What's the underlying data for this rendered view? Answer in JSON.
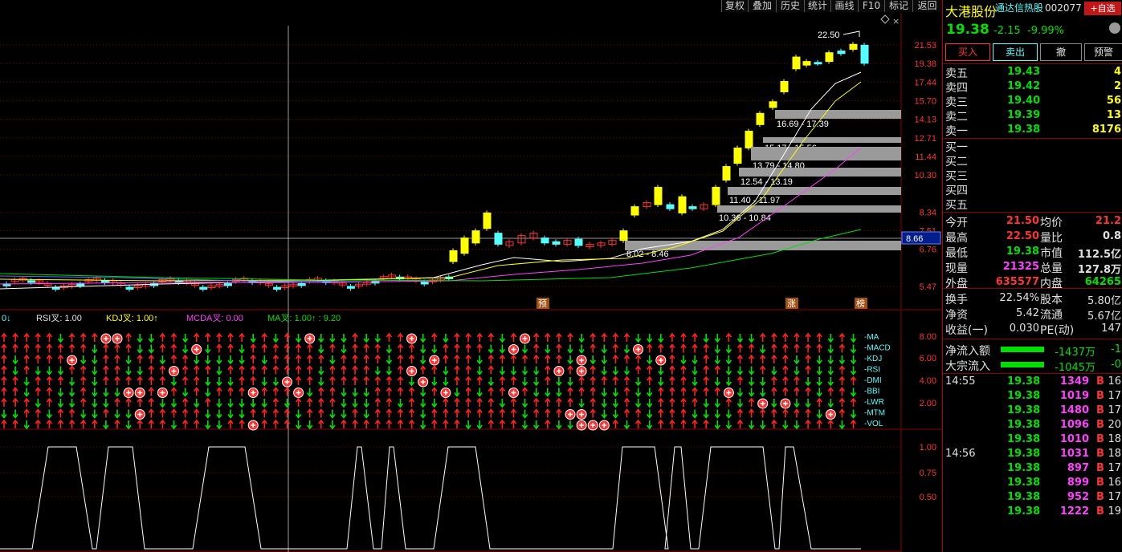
{
  "toolbar": {
    "buttons": [
      "复权",
      "叠加",
      "历史",
      "统计",
      "画线",
      "F10",
      "标记",
      "返回"
    ]
  },
  "colors": {
    "up": "#ff3232",
    "down": "#54ffff",
    "yellow": "#ffff00",
    "green": "#00e000",
    "grid": "#7a0000",
    "magenta": "#ff40ff",
    "gray": "#a0a0a0"
  },
  "main_chart": {
    "price_ticks": [
      "21.53",
      "19.38",
      "17.44",
      "15.70",
      "14.13",
      "12.71",
      "11.44",
      "10.30",
      "8.34",
      "7.51",
      "6.76",
      "5.47"
    ],
    "current_price_tag": "8.66",
    "high_label": "22.50",
    "zone_labels": [
      "16.69 - 17.39",
      "15.17 - 15.56",
      "13.79 - 14.80",
      "12.54 - 13.19",
      "11.40 - 11.97",
      "10.36 - 10.84",
      "8.02 - 8.46"
    ],
    "markers": [
      "预",
      "涨",
      "榜"
    ]
  },
  "indicator_header": {
    "items": [
      {
        "label": "RSI叉: 1.00"
      },
      {
        "label": "KDJ叉: 1.00↑"
      },
      {
        "label": "MCDA叉: 0.00"
      },
      {
        "label": "MA叉: 1.00↑  : 9.20"
      }
    ],
    "prefix": "0↓"
  },
  "signal_rows": {
    "labels": [
      "MA",
      "MACD",
      "KDJ",
      "RSI",
      "DMI",
      "BBI",
      "LWR",
      "MTM",
      "VOL"
    ],
    "axis": [
      "8.00",
      "6.00",
      "4.00",
      "2.00"
    ]
  },
  "bottom_axis": [
    "1.00",
    "0.75",
    "0.50"
  ],
  "quote": {
    "name": "大港股份",
    "source_link": "通达信热股",
    "code": "002077",
    "watch_button": "+自选",
    "price": "19.38",
    "change": "-2.15",
    "change_pct": "-9.99%",
    "buttons": [
      "买入",
      "卖出",
      "撤",
      "预警"
    ],
    "asks": [
      {
        "label": "卖五",
        "price": "19.43",
        "vol": "4"
      },
      {
        "label": "卖四",
        "price": "19.42",
        "vol": "2"
      },
      {
        "label": "卖三",
        "price": "19.40",
        "vol": "56"
      },
      {
        "label": "卖二",
        "price": "19.39",
        "vol": "13"
      },
      {
        "label": "卖一",
        "price": "19.38",
        "vol": "8176"
      }
    ],
    "bids": [
      {
        "label": "买一"
      },
      {
        "label": "买二"
      },
      {
        "label": "买三"
      },
      {
        "label": "买四"
      },
      {
        "label": "买五"
      }
    ],
    "stats": [
      {
        "l1": "今开",
        "v1": "21.50",
        "l2": "均价",
        "v2": "21.2"
      },
      {
        "l1": "最高",
        "v1": "22.50",
        "l2": "量比",
        "v2": "0.8"
      },
      {
        "l1": "最低",
        "v1": "19.38",
        "l2": "市值",
        "v2": "112.5亿"
      },
      {
        "l1": "现量",
        "v1": "21325",
        "l2": "总量",
        "v2": "127.8万"
      },
      {
        "l1": "外盘",
        "v1": "635577",
        "l2": "内盘",
        "v2": "64265"
      }
    ],
    "stats2": [
      {
        "l1": "换手",
        "v1": "22.54%",
        "l2": "股本",
        "v2": "5.80亿"
      },
      {
        "l1": "净资",
        "v1": "5.42",
        "l2": "流通",
        "v2": "5.67亿"
      },
      {
        "l1": "收益(一)",
        "v1": "0.030",
        "l2": "PE(动)",
        "v2": "147"
      }
    ],
    "flows": [
      {
        "label": "净流入额",
        "value": "-1437万",
        "extra": "-1"
      },
      {
        "label": "大宗流入",
        "value": "-1045万",
        "extra": "-0"
      }
    ],
    "ticks": [
      {
        "time": "14:55",
        "price": "19.38",
        "vol": "1349",
        "side": "B",
        "n": "16"
      },
      {
        "time": "",
        "price": "19.38",
        "vol": "1019",
        "side": "B",
        "n": "17"
      },
      {
        "time": "",
        "price": "19.38",
        "vol": "1480",
        "side": "B",
        "n": "17"
      },
      {
        "time": "",
        "price": "19.38",
        "vol": "1096",
        "side": "B",
        "n": "20"
      },
      {
        "time": "",
        "price": "19.38",
        "vol": "1010",
        "side": "B",
        "n": "18"
      },
      {
        "time": "14:56",
        "price": "19.38",
        "vol": "1031",
        "side": "B",
        "n": "18"
      },
      {
        "time": "",
        "price": "19.38",
        "vol": "897",
        "side": "B",
        "n": "17"
      },
      {
        "time": "",
        "price": "19.38",
        "vol": "899",
        "side": "B",
        "n": "16"
      },
      {
        "time": "",
        "price": "19.38",
        "vol": "952",
        "side": "B",
        "n": "17"
      },
      {
        "time": "",
        "price": "19.38",
        "vol": "1222",
        "side": "B",
        "n": "19"
      }
    ]
  }
}
